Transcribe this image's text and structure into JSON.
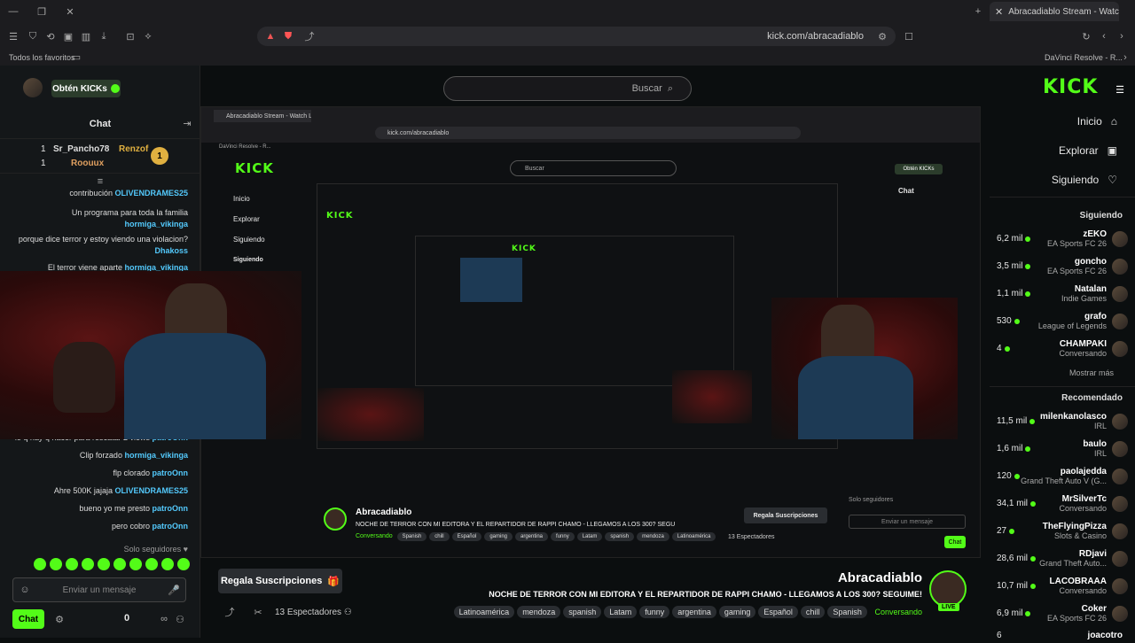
{
  "browser": {
    "tab_title": "Abracadiablo Stream - Watch Li",
    "url": "kick.com/abracadiablo",
    "bookmarks": [
      "Todos los favoritos"
    ],
    "bookmark_right": "DaVinci Resolve - R..."
  },
  "header": {
    "search_placeholder": "Buscar",
    "get_kicks": "Obtén KICKs",
    "logo": "KICK"
  },
  "nav": {
    "items": [
      {
        "label": "Inicio",
        "icon": "home-icon"
      },
      {
        "label": "Explorar",
        "icon": "browse-icon"
      },
      {
        "label": "Siguiendo",
        "icon": "heart-icon"
      }
    ]
  },
  "following": {
    "title": "Siguiendo",
    "items": [
      {
        "name": "zEKO",
        "game": "EA Sports FC 26",
        "viewers": "6,2 mil"
      },
      {
        "name": "goncho",
        "game": "EA Sports FC 26",
        "viewers": "3,5 mil"
      },
      {
        "name": "Natalan",
        "game": "Indie Games",
        "viewers": "1,1 mil"
      },
      {
        "name": "grafo",
        "game": "League of Legends",
        "viewers": "530"
      },
      {
        "name": "CHAMPAKI",
        "game": "Conversando",
        "viewers": "4"
      }
    ],
    "show_more": "Mostrar más"
  },
  "recommended": {
    "title": "Recomendado",
    "items": [
      {
        "name": "milenkanolasco",
        "game": "IRL",
        "viewers": "11,5 mil"
      },
      {
        "name": "baulo",
        "game": "IRL",
        "viewers": "1,6 mil"
      },
      {
        "name": "paolajedda",
        "game": "Grand Theft Auto V (G...",
        "viewers": "120"
      },
      {
        "name": "MrSilverTc",
        "game": "Conversando",
        "viewers": "34,1 mil"
      },
      {
        "name": "TheFlyingPizza",
        "game": "Slots & Casino",
        "viewers": "27"
      },
      {
        "name": "RDjavi",
        "game": "Grand Theft Auto...",
        "viewers": "28,6 mil"
      },
      {
        "name": "LACOBRAAA",
        "game": "Conversando",
        "viewers": "10,7 mil"
      },
      {
        "name": "Coker",
        "game": "EA Sports FC 26",
        "viewers": "6,9 mil"
      },
      {
        "name": "joacotro",
        "game": "",
        "viewers": "6"
      }
    ]
  },
  "chat": {
    "title": "Chat",
    "top_gifters": [
      {
        "name": "Renzof",
        "count": ""
      },
      {
        "name": "Sr_Pancho78",
        "count": "1"
      },
      {
        "name": "Roouux",
        "count": "1"
      }
    ],
    "messages_top": [
      {
        "user": "OLIVENDRAMES25",
        "text": "contribución"
      },
      {
        "user": "hormiga_vikinga",
        "text": "Un programa para toda la familia"
      },
      {
        "user": "Dhakoss",
        "text": "porque dice terror y estoy viendo una violacion?"
      },
      {
        "user": "hormiga_vikinga",
        "text": "El terror viene aparte"
      }
    ],
    "messages_bottom": [
      {
        "user": "patroOnn",
        "text": "lo q hay q hacer para rescatar 2 views"
      },
      {
        "user": "hormiga_vikinga",
        "text": "Clip forzado"
      },
      {
        "user": "patroOnn",
        "text": "flp clorado"
      },
      {
        "user": "OLIVENDRAMES25",
        "text": "Ahre 500K jajaja"
      },
      {
        "user": "patroOnn",
        "text": "bueno yo me presto"
      },
      {
        "user": "patroOnn",
        "text": "pero cobro"
      }
    ],
    "followers_only": "Solo seguidores",
    "input_placeholder": "Enviar un mensaje",
    "send_label": "Chat",
    "points": "0"
  },
  "stream": {
    "channel": "Abracadiablo",
    "title": "NOCHE DE TERROR CON MI EDITORA Y EL REPARTIDOR DE RAPPI CHAMO - LLEGAMOS A LOS 300? SEGUIME!",
    "category": "Conversando",
    "tags": [
      "Spanish",
      "chill",
      "Español",
      "gaming",
      "argentina",
      "funny",
      "Latam",
      "spanish",
      "mendoza",
      "Latinoamérica"
    ],
    "viewers": "13 Espectadores",
    "subscribe_label": "Regala Suscripciones",
    "live_badge": "LIVE"
  },
  "capture": {
    "tab_title": "Abracadiablo Stream - Watch Li",
    "url": "kick.com/abracadiablo",
    "bookmark": "DaVinci Resolve - R...",
    "search": "Buscar",
    "get_kicks": "Obtén KICKs",
    "chat_title": "Chat",
    "nav": [
      "Inicio",
      "Explorar",
      "Siguiendo"
    ],
    "following_title": "Siguiendo",
    "followers_only": "Solo seguidores",
    "input_placeholder": "Enviar un mensaje",
    "viewers": "13 Espectadores"
  },
  "colors": {
    "accent": "#53fc18",
    "bg": "#0b0e0f",
    "panel": "#141719"
  }
}
